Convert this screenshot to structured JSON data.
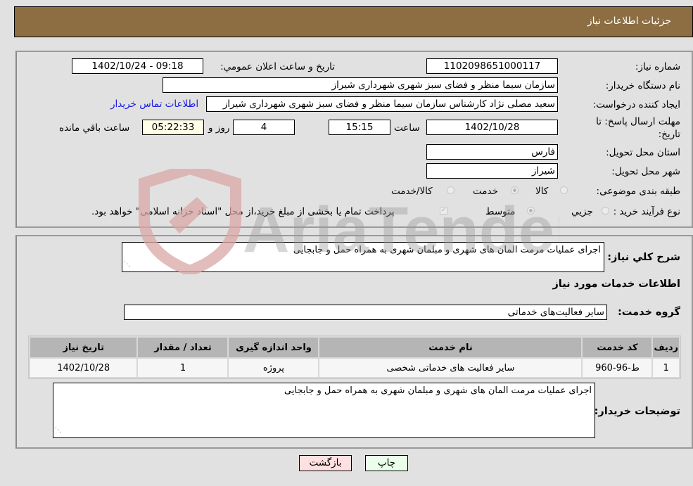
{
  "header": {
    "title": "جزئیات اطلاعات نیاز"
  },
  "details": {
    "need_number_label": "شماره نیاز:",
    "need_number": "1102098651000117",
    "announce_label": "تاریخ و ساعت اعلان عمومي:",
    "announce_value": "1402/10/24 - 09:18",
    "buyer_org_label": "نام دستگاه خریدار:",
    "buyer_org": "سازمان سیما منظر و فضای سبز شهری شهرداری شیراز",
    "creator_label": "ایجاد کننده درخواست:",
    "creator": "سعید مصلی نژاد کارشناس سازمان سیما منظر و فضای سبز شهری شهرداری شیراز",
    "contact_link": "اطلاعات تماس خریدار",
    "deadline_label": "مهلت ارسال پاسخ: تا تاریخ:",
    "deadline_date": "1402/10/28",
    "time_label": "ساعت",
    "deadline_time": "15:15",
    "days_value": "4",
    "days_label": "روز و",
    "remaining_time": "05:22:33",
    "remaining_label": "ساعت باقي مانده",
    "province_label": "استان محل تحویل:",
    "province": "فارس",
    "city_label": "شهر محل تحویل:",
    "city": "شیراز",
    "category_label": "طبقه بندی موضوعی:",
    "category_options": [
      {
        "label": "کالا",
        "selected": false
      },
      {
        "label": "خدمت",
        "selected": true
      },
      {
        "label": "کالا/خدمت",
        "selected": false
      }
    ],
    "process_label": "نوع فرآیند خرید :",
    "process_options": [
      {
        "label": "جزيي",
        "selected": false
      },
      {
        "label": "متوسط",
        "selected": true
      }
    ],
    "treasury_note": "پرداخت تمام یا بخشی از مبلغ خرید،از محل \"اسناد خزانه اسلامی\" خواهد بود.",
    "treasury_checked": true
  },
  "services": {
    "summary_label": "شرح كلي نياز:",
    "summary": "اجرای عملیات مرمت المان های شهری و مبلمان شهری به همراه حمل و جابجایی",
    "section_title": "اطلاعات خدمات مورد نیاز",
    "group_label": "گروه خدمت:",
    "group": "سایر فعالیت‌های خدماتی",
    "table": {
      "headers": [
        "ردیف",
        "کد خدمت",
        "نام خدمت",
        "واحد اندازه گیری",
        "تعداد / مقدار",
        "تاریخ نیاز"
      ],
      "rows": [
        [
          "1",
          "ط-96-960",
          "سایر فعالیت های خدماتی شخصی",
          "پروژه",
          "1",
          "1402/10/28"
        ]
      ]
    },
    "buyer_notes_label": "توضیحات خریدار:",
    "buyer_notes": "اجرای عملیات مرمت المان های شهری و مبلمان شهری به همراه حمل و جابجایی"
  },
  "buttons": {
    "print": "چاپ",
    "back": "بازگشت"
  },
  "watermark": {
    "text": "AriaTender.net"
  },
  "colors": {
    "header_bg": "#8d6e43",
    "print_bg": "#eaffea",
    "back_bg": "#ffe0e0",
    "link": "#1a1ae6"
  }
}
